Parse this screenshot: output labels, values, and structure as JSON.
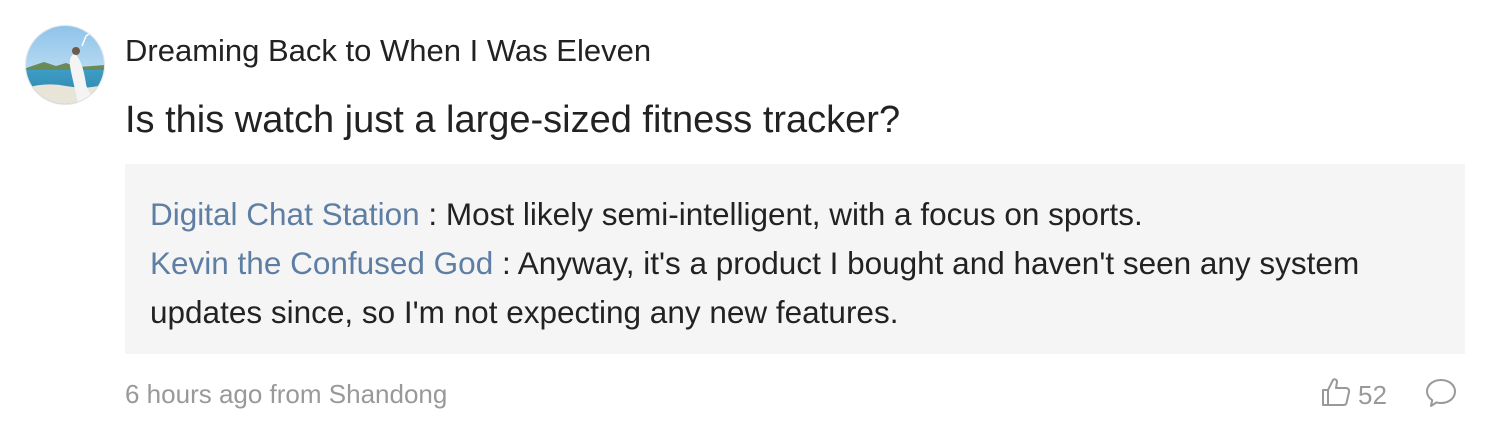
{
  "comment": {
    "username": "Dreaming Back to When I Was Eleven",
    "text": "Is this watch just a large-sized fitness tracker?",
    "replies": [
      {
        "author": "Digital Chat Station",
        "separator": " : ",
        "text": "Most likely semi-intelligent, with a focus on sports."
      },
      {
        "author": "Kevin the Confused God",
        "separator": " : ",
        "text": "Anyway, it's a product I bought and haven't seen any system updates since, so I'm not expecting any new features."
      }
    ],
    "meta": "6 hours ago from Shandong",
    "like_count": "52",
    "icons": {
      "like": "thumbs-up-icon",
      "comment": "comment-bubble-icon"
    },
    "colors": {
      "reply_author": "#5e7ea3",
      "reply_background": "#f5f5f5",
      "meta_text": "#999999"
    }
  }
}
